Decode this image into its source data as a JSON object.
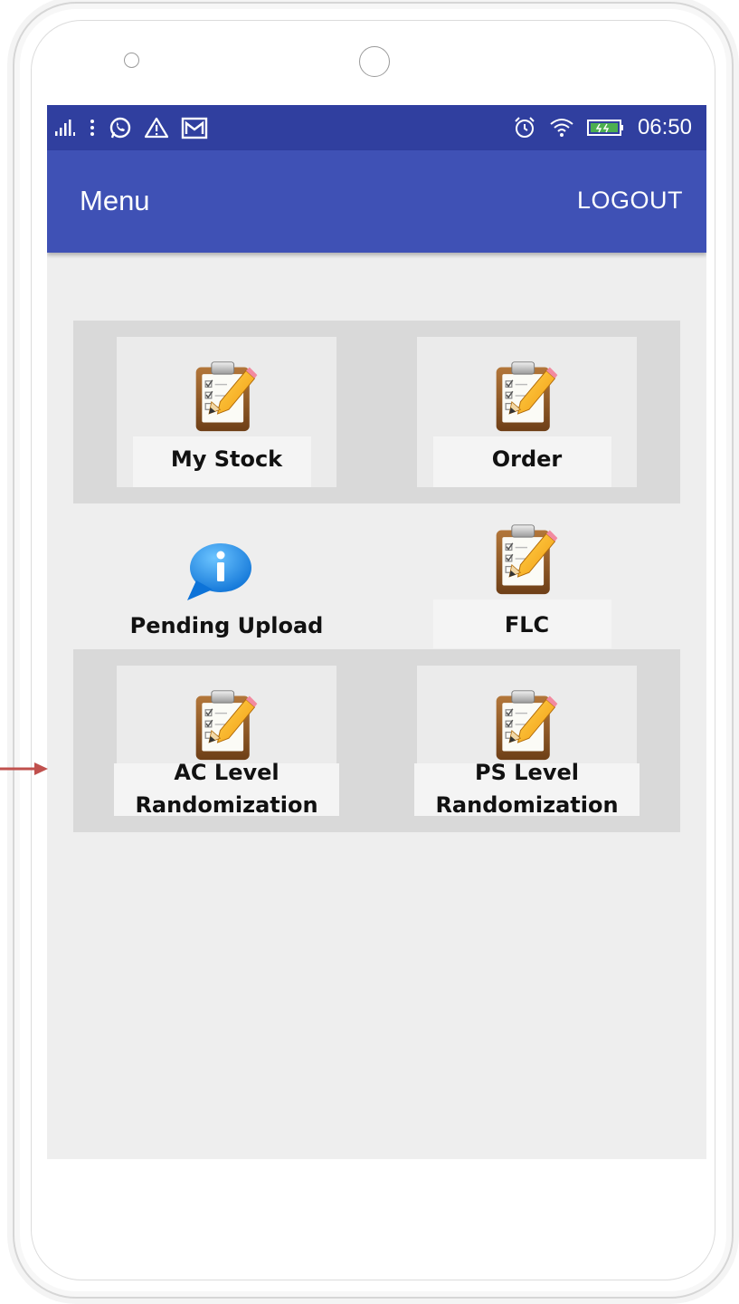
{
  "status_bar": {
    "time": "06:50",
    "icons_left": [
      "signal-icon",
      "more-icon",
      "whatsapp-icon",
      "warning-icon",
      "gmail-icon"
    ],
    "icons_right": [
      "alarm-icon",
      "wifi-icon",
      "battery-charging-icon"
    ]
  },
  "app_bar": {
    "title": "Menu",
    "logout_label": "LOGOUT"
  },
  "menu": {
    "items": [
      {
        "label": "My Stock",
        "icon": "clipboard-icon"
      },
      {
        "label": "Order",
        "icon": "clipboard-icon"
      },
      {
        "label": "Pending Upload",
        "icon": "info-bubble-icon"
      },
      {
        "label": "FLC",
        "icon": "clipboard-icon"
      },
      {
        "label_line1": "AC Level",
        "label_line2": "Randomization",
        "icon": "clipboard-icon"
      },
      {
        "label_line1": "PS Level",
        "label_line2": "Randomization",
        "icon": "clipboard-icon"
      }
    ]
  },
  "colors": {
    "status_bar": "#303f9f",
    "app_bar": "#3f51b5",
    "screen_bg": "#eeeeee",
    "arrow": "#c0504d"
  }
}
